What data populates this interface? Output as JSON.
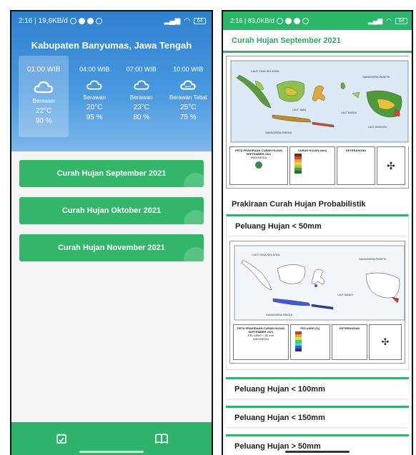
{
  "left": {
    "status": {
      "time_net": "2:16 | 19,6KB/d",
      "battery": "64"
    },
    "location": "Kabupaten Banyumas, Jawa Tengah",
    "forecast": [
      {
        "time": "01:00 WIB",
        "condition": "Berawan",
        "temp": "22°C",
        "humidity": "90 %",
        "icon": "cloud-icon"
      },
      {
        "time": "04:00 WIB",
        "condition": "Berawan",
        "temp": "20°C",
        "humidity": "95 %",
        "icon": "cloud-icon"
      },
      {
        "time": "07:00 WIB",
        "condition": "Berawan",
        "temp": "23°C",
        "humidity": "80 %",
        "icon": "cloud-icon"
      },
      {
        "time": "10:00 WIB",
        "condition": "Berawan Tebal",
        "temp": "25°C",
        "humidity": "75 %",
        "icon": "cloud-heavy-icon"
      }
    ],
    "buttons": [
      "Curah Hujan September 2021",
      "Curah Hujan Oktober 2021",
      "Curah Hujan November 2021"
    ],
    "nav": {
      "left_icon": "calendar-icon",
      "right_icon": "book-icon"
    }
  },
  "right": {
    "status": {
      "time_net": "2:16 | 83,0KB/d",
      "battery": "64"
    },
    "title": "Curah Hujan September 2021",
    "section": "Prakiraan Curah Hujan Probabilistik",
    "prob_open": "Peluang Hujan < 50mm",
    "prob_items": [
      "Peluang Hujan < 100mm",
      "Peluang Hujan < 150mm",
      "Peluang Hujan > 50mm"
    ],
    "map1": {
      "sea_labels": [
        "LAUT CINA SELATAN",
        "SAMUDERA PASIFIK",
        "LAUT JAWA",
        "SAMUDERA HINDIA",
        "LAUT BANDA",
        "LAUT ARAFURU"
      ],
      "legend_title": "PETA PRAKIRAAN CURAH HUJAN",
      "legend_month": "SEPTEMBER 2021",
      "legend_country": "INDONESIA",
      "legend_rain": "CURAH HUJAN (mm)",
      "legend_info": "KETERANGAN"
    },
    "map2": {
      "sea_labels": [
        "LAUT CINA SELATAN",
        "SAMUDERA PASIFIK",
        "SAMUDERA HINDIA",
        "LAUT BANDA"
      ],
      "legend_title": "PETA PRAKIRAAN CURAH HUJAN",
      "legend_month": "SEPTEMBER 2021",
      "legend_sub": "PELUANG < 50 mm",
      "legend_country": "INDONESIA",
      "legend_rain": "PELUANG (%)",
      "legend_info": "KETERANGAN"
    }
  },
  "colors": {
    "green": "#2db56a",
    "sky": "#3a8ad8"
  }
}
